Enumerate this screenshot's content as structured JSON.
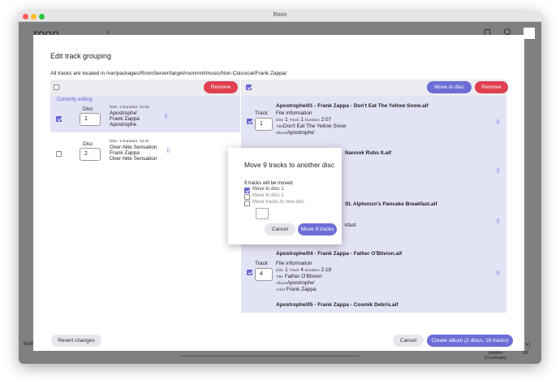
{
  "window": {
    "title": "Roon"
  },
  "roon_bar": {
    "logo": "roon"
  },
  "background": {
    "now_playing": "Nothi",
    "zone_name": "Jukebox",
    "zone_sub": "(CoreAudio)",
    "volume": "100"
  },
  "dialog": {
    "title": "Edit track grouping",
    "path": "All tracks are located in /var/packages/RoonServer/target/roonmnt/music/Non-Classical/Frank Zappa/",
    "left_remove": "Remove",
    "right_move": "Move to disc",
    "right_remove": "Remove",
    "currently_editing": "Currently editing",
    "discs": [
      {
        "label": "Disc",
        "number": "1",
        "meta": "Disc: 1  Duration: 31:53",
        "lines": [
          "Apostrophe'",
          "Frank Zappa",
          "Apostrophe"
        ]
      },
      {
        "label": "Disc",
        "number": "2",
        "meta": "Disc: 1  Duration: 34:31",
        "lines": [
          "Over-Nite Sensation",
          "Frank Zappa",
          "Over-Nite Sensation"
        ]
      }
    ],
    "tracks": [
      {
        "filename": "Apostrophe/01 - Frank Zappa - Don't Eat The Yellow Snow.aif",
        "label": "Track",
        "number": "1",
        "file_info": "File information",
        "disc_key": "Disc",
        "disc_val": "1",
        "track_key": "Track",
        "track_val": "1",
        "dur_key": "Duration",
        "dur_val": "2:07",
        "title_key": "Title",
        "title_val": "Don't Eat The Yellow Snow",
        "album_key": "Album",
        "album_val": "Apostrophe'"
      },
      {
        "filename_fragment": "Nanook Rubs It.aif"
      },
      {
        "filename_fragment": "St. Alphonzo's Pancake Breakfast.aif",
        "extra_fragment": "kfast"
      },
      {
        "filename": "Apostrophe/04 - Frank Zappa - Father O'Blivion.aif",
        "label": "Track",
        "number": "4",
        "file_info": "File information",
        "disc_key": "Disc",
        "disc_val": "1",
        "track_key": "Track",
        "track_val": "4",
        "dur_key": "Duration",
        "dur_val": "2:18",
        "title_key": "Title",
        "title_val": "Father O'Blivion",
        "album_key": "Album",
        "album_val": "Apostrophe'",
        "artist_key": "Artist",
        "artist_val": "Frank Zappa"
      },
      {
        "filename": "Apostrophe/05 - Frank Zappa - Cosmik Debris.aif"
      }
    ],
    "revert": "Revert changes",
    "cancel": "Cancel",
    "create": "Create album (2 discs, 16 tracks)"
  },
  "modal": {
    "title": "Move 9 tracks to another disc",
    "subtitle": "9 tracks will be moved:",
    "options": [
      {
        "label": "Move to disc 1",
        "checked": true
      },
      {
        "label": "Move to disc 2",
        "checked": false
      },
      {
        "label": "Move tracks to new disc",
        "checked": false
      }
    ],
    "cancel": "Cancel",
    "confirm": "Move 9 tracks"
  },
  "colors": {
    "accent": "#6c6ed6",
    "danger": "#e0404f",
    "panel": "#e3e3f6"
  }
}
